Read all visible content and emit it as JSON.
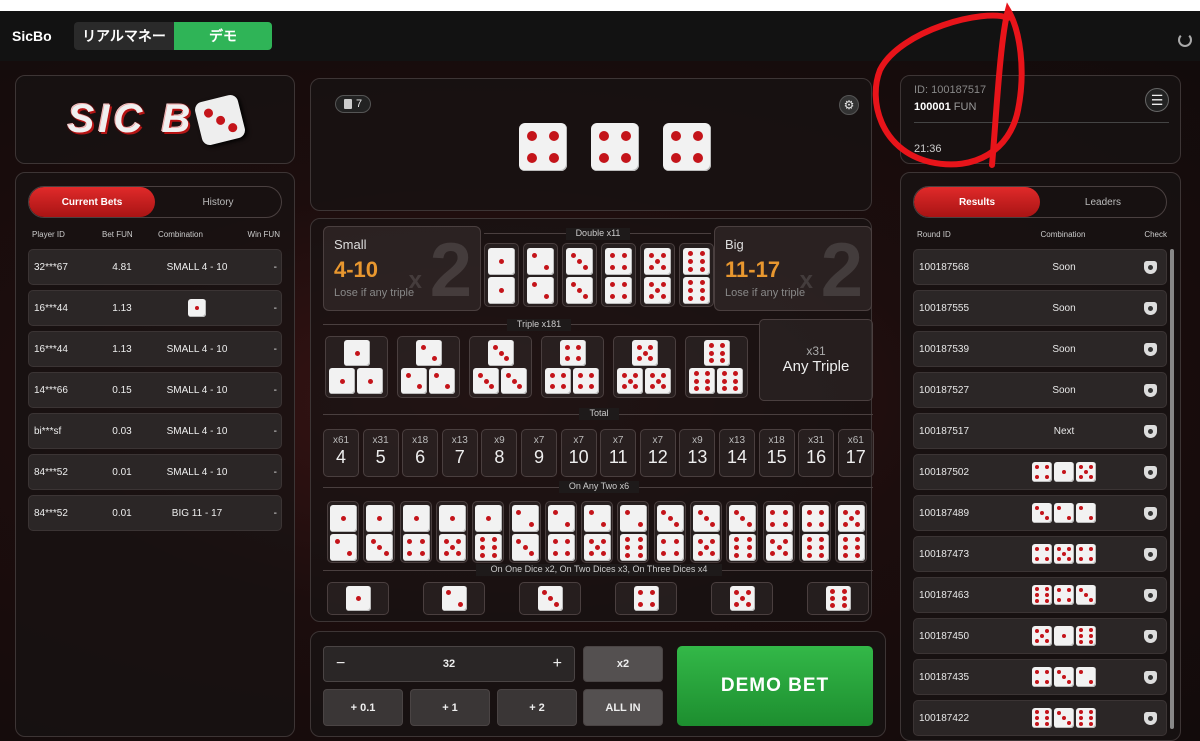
{
  "header": {
    "app_title": "SicBo",
    "mode_real": "リアルマネー",
    "mode_demo": "デモ"
  },
  "logo": {
    "text": "SIC B"
  },
  "bets": {
    "tabs": [
      "Current Bets",
      "History"
    ],
    "columns": [
      "Player ID",
      "Bet  FUN",
      "Combination",
      "Win  FUN"
    ],
    "rows": [
      {
        "player": "32***67",
        "bet": "4.81",
        "combination": "SMALL 4 - 10",
        "win": "-"
      },
      {
        "player": "16***44",
        "bet": "1.13",
        "combination": "",
        "win": "-"
      },
      {
        "player": "16***44",
        "bet": "1.13",
        "combination": "SMALL 4 - 10",
        "win": "-"
      },
      {
        "player": "14***66",
        "bet": "0.15",
        "combination": "SMALL 4 - 10",
        "win": "-"
      },
      {
        "player": "bi***sf",
        "bet": "0.03",
        "combination": "SMALL 4 - 10",
        "win": "-"
      },
      {
        "player": "84***52",
        "bet": "0.01",
        "combination": "SMALL 4 - 10",
        "win": "-"
      },
      {
        "player": "84***52",
        "bet": "0.01",
        "combination": "BIG 11 - 17",
        "win": "-"
      }
    ]
  },
  "game": {
    "history_count": "7",
    "dice": [
      4,
      4,
      4
    ]
  },
  "board": {
    "small": {
      "title": "Small",
      "range": "4-10",
      "note": "Lose if any triple",
      "mult": "2",
      "x": "x"
    },
    "big": {
      "title": "Big",
      "range": "11-17",
      "note": "Lose if any triple",
      "mult": "2",
      "x": "x"
    },
    "double_label": "Double x11",
    "triple_label": "Triple x181",
    "any_triple": {
      "mult": "x31",
      "label": "Any Triple"
    },
    "total_label": "Total",
    "totals": [
      {
        "m": "x61",
        "n": "4"
      },
      {
        "m": "x31",
        "n": "5"
      },
      {
        "m": "x18",
        "n": "6"
      },
      {
        "m": "x13",
        "n": "7"
      },
      {
        "m": "x9",
        "n": "8"
      },
      {
        "m": "x7",
        "n": "9"
      },
      {
        "m": "x7",
        "n": "10"
      },
      {
        "m": "x7",
        "n": "11"
      },
      {
        "m": "x7",
        "n": "12"
      },
      {
        "m": "x9",
        "n": "13"
      },
      {
        "m": "x13",
        "n": "14"
      },
      {
        "m": "x18",
        "n": "15"
      },
      {
        "m": "x31",
        "n": "16"
      },
      {
        "m": "x61",
        "n": "17"
      }
    ],
    "any_two_label": "On Any Two x6",
    "single_label": "On One Dice x2, On Two Dices x3, On Three Dices x4"
  },
  "bet_controls": {
    "minus": "−",
    "amount": "32",
    "plus": "+",
    "double": "x2",
    "add01": "+ 0.1",
    "add1": "+ 1",
    "add2": "+ 2",
    "all_in": "ALL IN",
    "demo_bet": "DEMO BET"
  },
  "account": {
    "id_label": "ID: 100187517",
    "balance": "100001",
    "currency": "FUN",
    "time": "21:36"
  },
  "results": {
    "tabs": [
      "Results",
      "Leaders"
    ],
    "columns": [
      "Round ID",
      "Combination",
      "Check"
    ],
    "rows": [
      {
        "round": "100187568",
        "combo": "Soon"
      },
      {
        "round": "100187555",
        "combo": "Soon"
      },
      {
        "round": "100187539",
        "combo": "Soon"
      },
      {
        "round": "100187527",
        "combo": "Soon"
      },
      {
        "round": "100187517",
        "combo": "Next"
      },
      {
        "round": "100187502",
        "combo": ""
      },
      {
        "round": "100187489",
        "combo": ""
      },
      {
        "round": "100187473",
        "combo": ""
      },
      {
        "round": "100187463",
        "combo": ""
      },
      {
        "round": "100187450",
        "combo": ""
      },
      {
        "round": "100187435",
        "combo": ""
      },
      {
        "round": "100187422",
        "combo": ""
      }
    ],
    "dice": [
      [
        null
      ],
      [
        null
      ],
      [
        null
      ],
      [
        null
      ],
      [
        null
      ],
      [
        4,
        1,
        5
      ],
      [
        3,
        2,
        2
      ],
      [
        4,
        5,
        4
      ],
      [
        6,
        4,
        3
      ],
      [
        5,
        1,
        6
      ],
      [
        4,
        3,
        2
      ],
      [
        6,
        3,
        6
      ]
    ]
  },
  "colors": {
    "accent_red": "#e02a2a",
    "demo_green": "#2fb457",
    "gold": "#e8972f",
    "annotation": "#e8141a"
  }
}
